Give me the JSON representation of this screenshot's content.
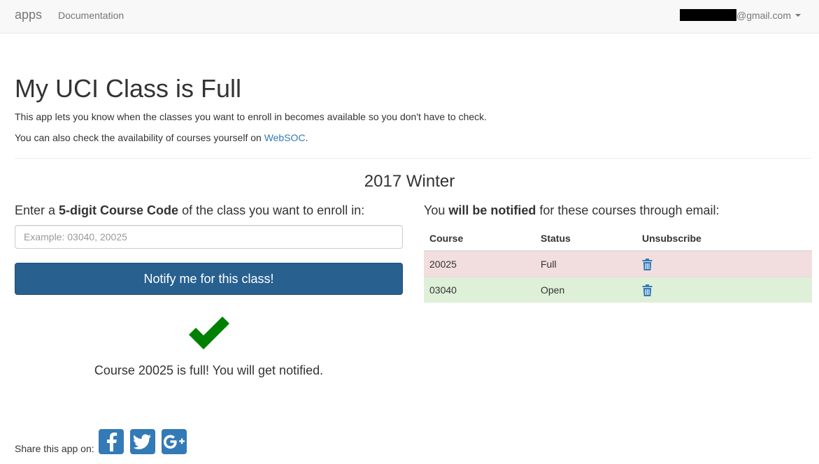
{
  "navbar": {
    "brand": "apps",
    "documentation_label": "Documentation",
    "user_email_suffix": "@gmail.com"
  },
  "header": {
    "title": "My UCI Class is Full",
    "intro_line1": "This app lets you know when the classes you want to enroll in becomes available so you don't have to check.",
    "intro_line2_prefix": "You can also check the availability of courses yourself on ",
    "intro_line2_link": "WebSOC",
    "intro_line2_suffix": "."
  },
  "term": "2017 Winter",
  "enroll": {
    "label_prefix": "Enter a ",
    "label_bold": "5-digit Course Code",
    "label_suffix": " of the class you want to enroll in:",
    "input_placeholder": "Example: 03040, 20025",
    "input_value": "",
    "button_label": "Notify me for this class!",
    "result_icon": "checkmark-icon",
    "result_message": "Course 20025 is full! You will get notified."
  },
  "subscriptions": {
    "label_prefix": "You ",
    "label_bold": "will be notified",
    "label_suffix": " for these courses through email:",
    "columns": [
      "Course",
      "Status",
      "Unsubscribe"
    ],
    "rows": [
      {
        "course": "20025",
        "status": "Full",
        "unsubscribe_icon": "trash-icon"
      },
      {
        "course": "03040",
        "status": "Open",
        "unsubscribe_icon": "trash-icon"
      }
    ]
  },
  "share": {
    "label": "Share this app on:",
    "icons": [
      "facebook-icon",
      "twitter-icon",
      "google-plus-icon"
    ]
  },
  "colors": {
    "primary": "#286090",
    "link": "#337ab7",
    "danger_row": "#f2dede",
    "success_row": "#dff0d8",
    "check": "#008000"
  }
}
